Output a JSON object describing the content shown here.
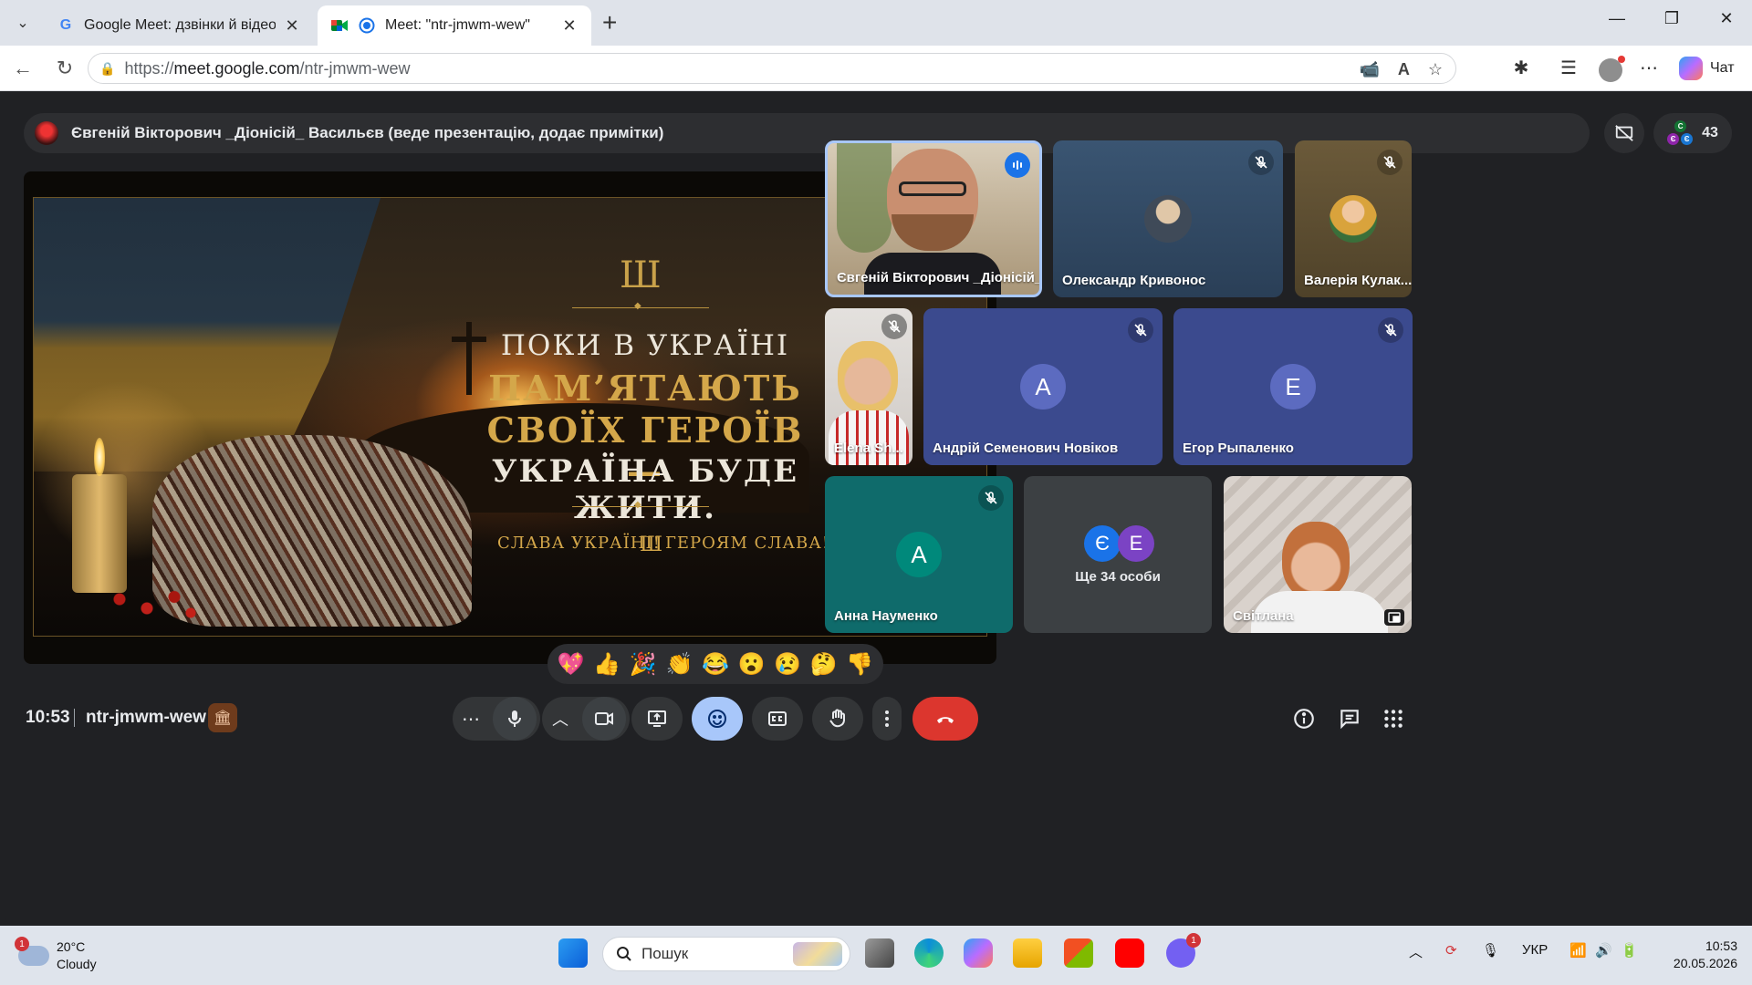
{
  "browser": {
    "tabs": [
      {
        "title": "Google Meet: дзвінки й відеоконференції",
        "active": false
      },
      {
        "title": "Meet: \"ntr-jmwm-wew\"",
        "active": true
      }
    ],
    "url_prefix": "https://",
    "url_host": "meet.google.com",
    "url_path": "/ntr-jmwm-wew",
    "copilot_label": "Чат"
  },
  "meet": {
    "presenter_text": "Євгеній Вікторович _Діонісій_ Васильєв (веде презентацію, додає примітки)",
    "participants_count": "43",
    "mini_avatar_letters": [
      "С",
      "Є",
      "Є"
    ],
    "slide": {
      "line1": "ПОКИ В УКРАЇНІ",
      "line2": "ПАМ’ЯТАЮТЬ",
      "line3": "СВОЇХ ГЕРОЇВ —",
      "line4": "УКРАЇНА БУДЕ ЖИТИ.",
      "slogan_left": "СЛАВА УКРАЇНІ!",
      "slogan_right": "ГЕРОЯМ СЛАВА!",
      "trident": "🔱"
    },
    "tiles": [
      {
        "name": "Євгеній Вікторович _Діонісій_ Ва...",
        "speaking": true
      },
      {
        "name": "Олександр Кривонос",
        "muted": true
      },
      {
        "name": "Валерія Кулак...",
        "muted": true
      },
      {
        "name": "Elena Sh...",
        "muted": true
      },
      {
        "name": "Андрій Семенович Новіков",
        "letter": "А",
        "muted": true
      },
      {
        "name": "Егор Рыпаленко",
        "letter": "Е",
        "muted": true
      },
      {
        "name": "Анна Науменко",
        "letter": "А",
        "muted": true
      },
      {
        "name": "Ще 34 особи",
        "letters": [
          "Є",
          "Е"
        ]
      },
      {
        "name": "Світлана"
      }
    ],
    "reactions": [
      "💖",
      "👍",
      "🎉",
      "👏",
      "😂",
      "😮",
      "😢",
      "🤔",
      "👎"
    ],
    "clock": "10:53",
    "meeting_code": "ntr-jmwm-wew"
  },
  "taskbar": {
    "weather_temp": "20°C",
    "weather_desc": "Cloudy",
    "weather_badge": "1",
    "search_label": "Пошук",
    "language": "УКР",
    "time": "10:53",
    "date": "20.05.2026",
    "viber_badge": "1"
  },
  "colors": {
    "meet_bg": "#202124",
    "tile_blue": "#3b4a8e",
    "tile_teal": "#0f6b6b",
    "end_call": "#dc362e",
    "reactions_active": "#a8c7fa"
  }
}
